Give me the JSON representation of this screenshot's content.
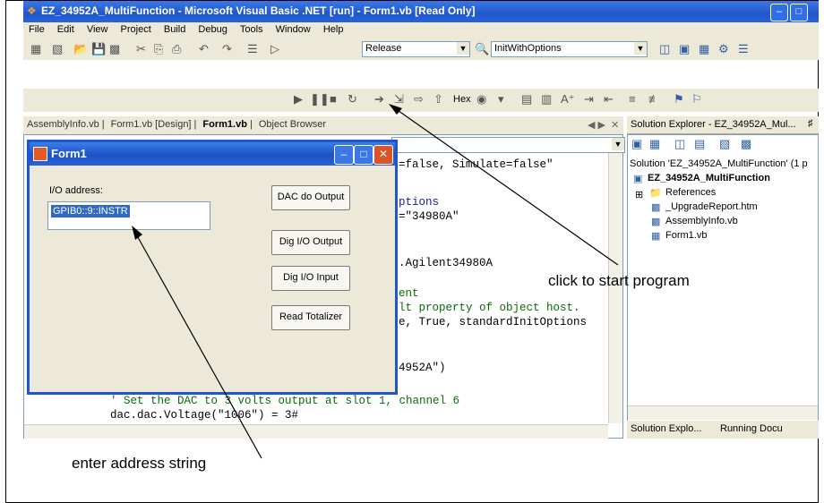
{
  "vs": {
    "title": "EZ_34952A_MultiFunction - Microsoft Visual Basic .NET [run] - Form1.vb [Read Only]",
    "menu": [
      "File",
      "Edit",
      "View",
      "Project",
      "Build",
      "Debug",
      "Tools",
      "Window",
      "Help"
    ],
    "toolbar": {
      "config": "Release",
      "startup": "InitWithOptions",
      "hex": "Hex"
    },
    "doc_tabs": [
      "AssemblyInfo.vb",
      "Form1.vb [Design]",
      "Form1.vb",
      "Object Browser"
    ],
    "code_lines": [
      "=false, Simulate=false\"",
      "ptions",
      "=\"34980A\"",
      ".Agilent34980A",
      "ent",
      "lt property of object host.",
      "e, True, standardInitOptions",
      "4952A\")",
      "' Set the DAC to 3 volts output at slot 1, channel 6",
      "dac.dac.Voltage(\"1006\") = 3#"
    ]
  },
  "solution_explorer": {
    "title": "Solution Explorer - EZ_34952A_Mul...",
    "items": [
      "Solution 'EZ_34952A_MultiFunction' (1 p",
      "EZ_34952A_MultiFunction",
      "References",
      "_UpgradeReport.htm",
      "AssemblyInfo.vb",
      "Form1.vb"
    ],
    "tabs": [
      "Solution Explo...",
      "Running Docu"
    ]
  },
  "form1": {
    "title": "Form1",
    "io_label": "I/O address:",
    "io_value": "GPIB0::9::INSTR",
    "buttons": [
      "DAC do Output",
      "Dig I/O Output",
      "Dig I/O Input",
      "Read Totalizer"
    ]
  },
  "annotations": {
    "start_program": "click to start program",
    "enter_address": "enter address string"
  }
}
